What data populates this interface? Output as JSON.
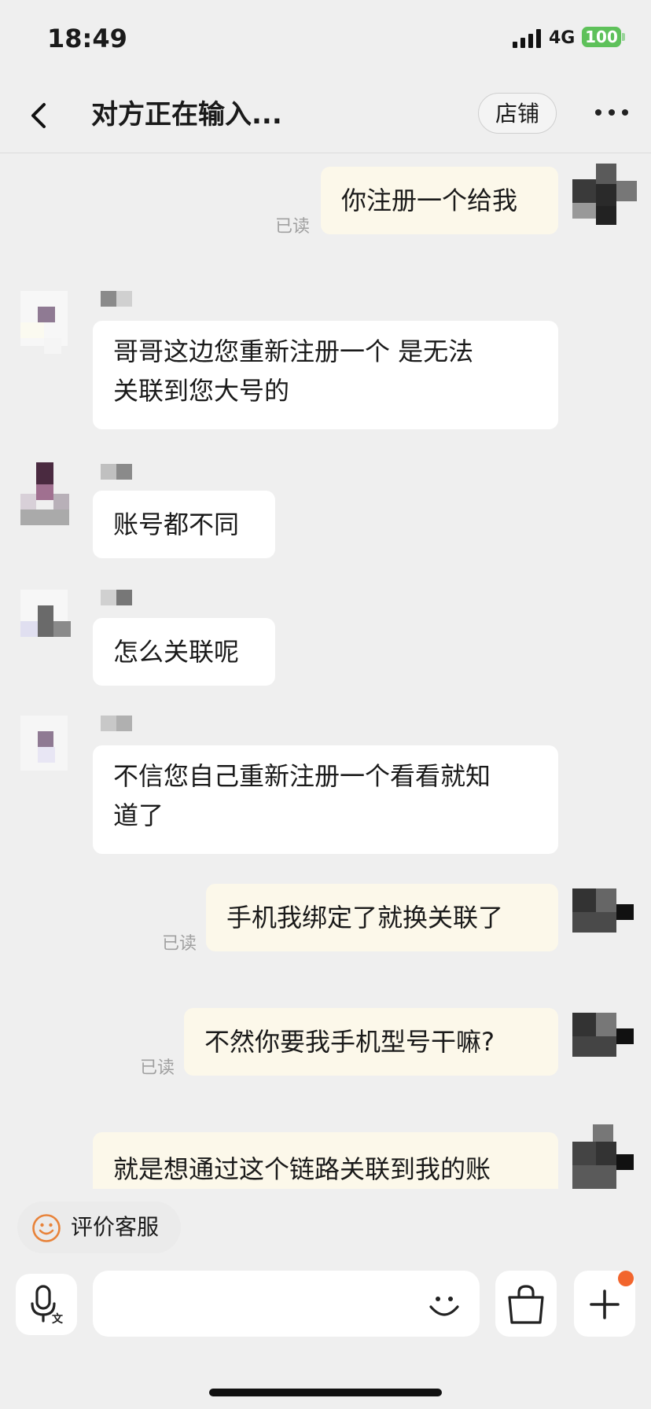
{
  "status_bar": {
    "time": "18:49",
    "network": "4G",
    "battery": "100"
  },
  "nav": {
    "title": "对方正在输入...",
    "store_label": "店铺"
  },
  "messages": [
    {
      "side": "out",
      "text": "你注册一个给我",
      "status": "已读"
    },
    {
      "side": "in",
      "line1": "哥哥这边您重新注册一个 是无法",
      "line2": "关联到您大号的"
    },
    {
      "side": "in",
      "text": "账号都不同"
    },
    {
      "side": "in",
      "text": "怎么关联呢"
    },
    {
      "side": "in",
      "line1": "不信您自己重新注册一个看看就知",
      "line2": "道了"
    },
    {
      "side": "out",
      "text": "手机我绑定了就换关联了",
      "status": "已读"
    },
    {
      "side": "out",
      "text": "不然你要我手机型号干嘛?",
      "status": "已读"
    },
    {
      "side": "out",
      "text": "就是想通过这个链路关联到我的账"
    }
  ],
  "review": {
    "label": "评价客服"
  },
  "input": {
    "placeholder": ""
  },
  "colors": {
    "accent": "#f2652d",
    "out_bubble": "#fcf8ea",
    "in_bubble": "#ffffff",
    "battery": "#5ec15a"
  },
  "icons": [
    "back-icon",
    "more-icon",
    "smile-icon",
    "voice-icon",
    "emoji-icon",
    "shopping-bag-icon",
    "plus-icon"
  ]
}
